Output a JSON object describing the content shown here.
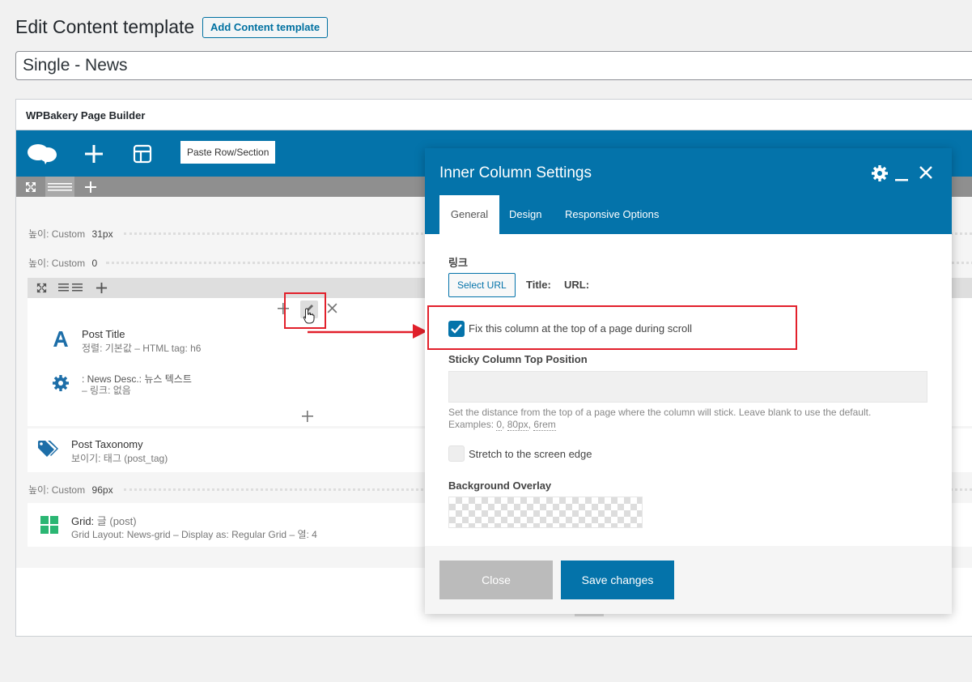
{
  "page": {
    "title": "Edit Content template",
    "add_button": "Add Content template",
    "post_title": "Single - News"
  },
  "builder": {
    "header": "WPBakery Page Builder",
    "toolbar": {
      "paste_label": "Paste Row/Section"
    },
    "separators": [
      {
        "label": "높이: Custom",
        "value": "31px"
      },
      {
        "label": "높이: Custom",
        "value": "0"
      },
      {
        "label": "높이: Custom",
        "value": "96px"
      }
    ],
    "elements": {
      "post_title": {
        "title": "Post Title",
        "sub": "정렬: 기본값  – HTML tag: h6"
      },
      "news_desc": {
        "title": ": News Desc.: 뉴스 텍스트",
        "sub": "– 링크: 없음"
      },
      "post_taxonomy": {
        "title": "Post Taxonomy",
        "sub": "보이기: 태그 (post_tag)"
      },
      "grid": {
        "title_key": "Grid:",
        "title_val": "글 (post)",
        "sub": "Grid Layout: News-grid  –  Display as: Regular Grid  –  열: 4"
      }
    }
  },
  "modal": {
    "title": "Inner Column Settings",
    "tabs": [
      "General",
      "Design",
      "Responsive Options"
    ],
    "link_label": "링크",
    "select_url": "Select URL",
    "title_label": "Title:",
    "url_label": "URL:",
    "fix_checkbox": "Fix this column at the top of a page during scroll",
    "sticky_label": "Sticky Column Top Position",
    "sticky_value": "",
    "hint_line1": "Set the distance from the top of a page where the column will stick. Leave blank to use the default.",
    "hint_prefix": "Examples: ",
    "hint_ex1": "0",
    "hint_ex2": "80px",
    "hint_ex3": "6rem",
    "stretch_checkbox": "Stretch to the screen edge",
    "overlay_label": "Background Overlay",
    "close": "Close",
    "save": "Save changes"
  },
  "colors": {
    "accent": "#0473aa",
    "highlight": "#e2202b",
    "grid_icon": "#2bb673"
  }
}
